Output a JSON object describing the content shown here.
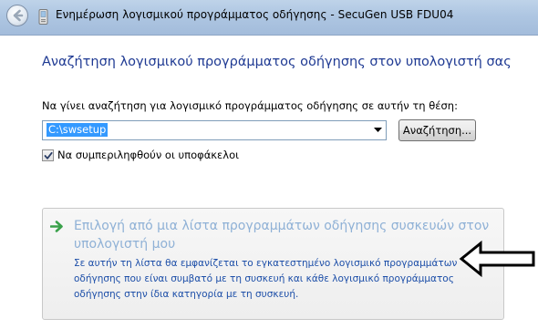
{
  "window": {
    "title": "Ενημέρωση λογισμικού προγράμματος οδήγησης - SecuGen USB FDU04"
  },
  "main": {
    "heading": "Αναζήτηση λογισμικού προγράμματος οδήγησης στον υπολογιστή σας",
    "search_label": "Να γίνει αναζήτηση για λογισμικό προγράμματος οδήγησης σε αυτήν τη θέση:",
    "path_value": "C:\\swsetup",
    "browse_label": "Αναζήτηση...",
    "include_subfolders_label": "Να συμπεριληφθούν οι υποφάκελοι",
    "include_subfolders_checked": true
  },
  "command_link": {
    "title": "Επιλογή από μια λίστα προγραμμάτων οδήγησης συσκευών στον υπολογιστή μου",
    "description": "Σε αυτήν τη λίστα θα εμφανίζεται το εγκατεστημένο λογισμικό προγραμμάτων οδήγησης που είναι συμβατό με τη συσκευή και κάθε λογισμικό προγράμματος οδήγησης στην ίδια κατηγορία με τη συσκευή."
  },
  "icons": {
    "back": "back-arrow-icon",
    "title": "device-icon",
    "command_link": "green-arrow-icon",
    "callout": "callout-arrow-icon"
  },
  "colors": {
    "heading": "#1f3a93",
    "link_title": "#8fb1d6",
    "link_desc": "#1c4ea8",
    "selection": "#3399ff"
  }
}
